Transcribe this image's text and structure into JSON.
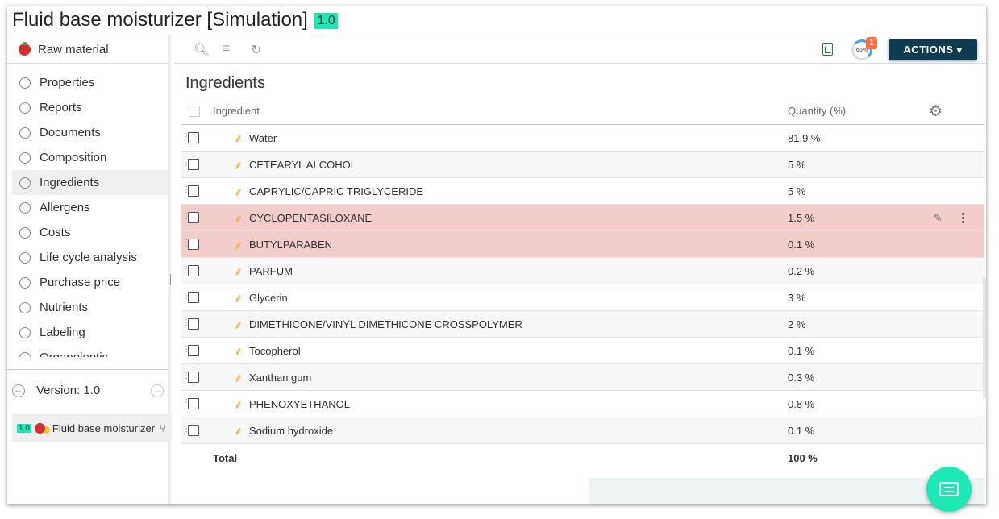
{
  "title": {
    "text": "Fluid base moisturizer [Simulation]",
    "version_badge": "1.0"
  },
  "sidebar": {
    "header_label": "Raw material",
    "items": [
      {
        "label": "Properties"
      },
      {
        "label": "Reports"
      },
      {
        "label": "Documents"
      },
      {
        "label": "Composition"
      },
      {
        "label": "Ingredients",
        "active": true
      },
      {
        "label": "Allergens"
      },
      {
        "label": "Costs"
      },
      {
        "label": "Life cycle analysis"
      },
      {
        "label": "Purchase price"
      },
      {
        "label": "Nutrients"
      },
      {
        "label": "Labeling"
      },
      {
        "label": "Organoleptic"
      }
    ],
    "version_label": "Version: 1.0",
    "product": {
      "badge": "1.0",
      "name": "Fluid base moisturizer"
    }
  },
  "toolbar": {
    "icons": [
      "search-icon",
      "add-list-icon",
      "refresh-icon",
      "excel-export-icon"
    ],
    "progress_label": "66%",
    "notification_count": "1",
    "actions_label": "ACTIONS ▾"
  },
  "main": {
    "section_title": "Ingredients",
    "columns": {
      "ingredient": "Ingredient",
      "quantity": "Quantity (%)"
    },
    "rows": [
      {
        "name": "Water",
        "qty": "81.9 %",
        "highlight": false
      },
      {
        "name": "CETEARYL ALCOHOL",
        "qty": "5 %",
        "highlight": false
      },
      {
        "name": "CAPRYLIC/CAPRIC TRIGLYCERIDE",
        "qty": "5 %",
        "highlight": false
      },
      {
        "name": "CYCLOPENTASILOXANE",
        "qty": "1.5 %",
        "highlight": true
      },
      {
        "name": "BUTYLPARABEN",
        "qty": "0.1 %",
        "highlight": true
      },
      {
        "name": "PARFUM",
        "qty": "0.2 %",
        "highlight": false
      },
      {
        "name": "Glycerin",
        "qty": "3 %",
        "highlight": false
      },
      {
        "name": "DIMETHICONE/VINYL DIMETHICONE CROSSPOLYMER",
        "qty": "2 %",
        "highlight": false
      },
      {
        "name": "Tocopherol",
        "qty": "0.1 %",
        "highlight": false
      },
      {
        "name": "Xanthan gum",
        "qty": "0.3 %",
        "highlight": false
      },
      {
        "name": "PHENOXYETHANOL",
        "qty": "0.8 %",
        "highlight": false
      },
      {
        "name": "Sodium hydroxide",
        "qty": "0.1 %",
        "highlight": false
      }
    ],
    "total_label": "Total",
    "total_qty": "100 %"
  },
  "colors": {
    "accent_badge": "#1de9b6",
    "actions_button": "#0d3b4f",
    "highlight_row": "#f3cccc",
    "ingredient_icon": "#f5a623",
    "notification": "#ff7043"
  }
}
